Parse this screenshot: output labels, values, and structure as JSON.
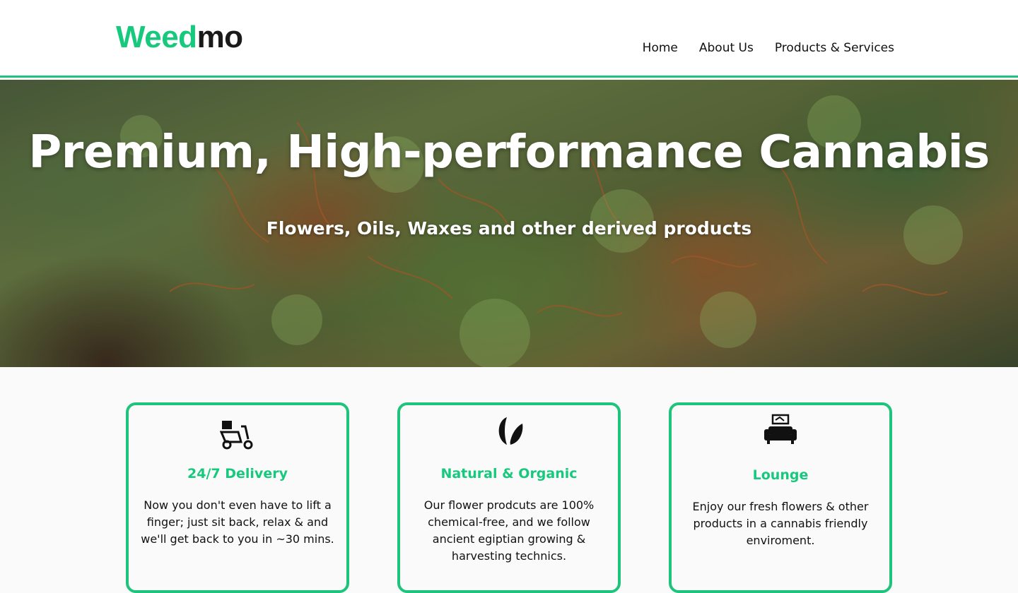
{
  "header": {
    "logo": {
      "part1": "Weed",
      "part2": "mo",
      "color_accent": "#17c97d"
    },
    "nav": [
      {
        "label": "Home"
      },
      {
        "label": "About Us"
      },
      {
        "label": "Products & Services"
      }
    ],
    "border_color": "#1ec47b"
  },
  "hero": {
    "title": "Premium, High-performance Cannabis",
    "subtitle": "Flowers, Oils, Waxes and other derived products"
  },
  "features": [
    {
      "icon": "delivery-scooter-icon",
      "title": "24/7 Delivery",
      "description": "Now you don't even have to lift a finger; just sit back, relax & and we'll get back to you in ~30 mins."
    },
    {
      "icon": "leaf-icon",
      "title": "Natural & Organic",
      "description": "Our flower prodcuts are 100% chemical-free, and we follow ancient egiptian growing & harvesting technics."
    },
    {
      "icon": "sofa-icon",
      "title": "Lounge",
      "description": "Enjoy our fresh flowers & other products in a cannabis friendly enviroment."
    }
  ]
}
